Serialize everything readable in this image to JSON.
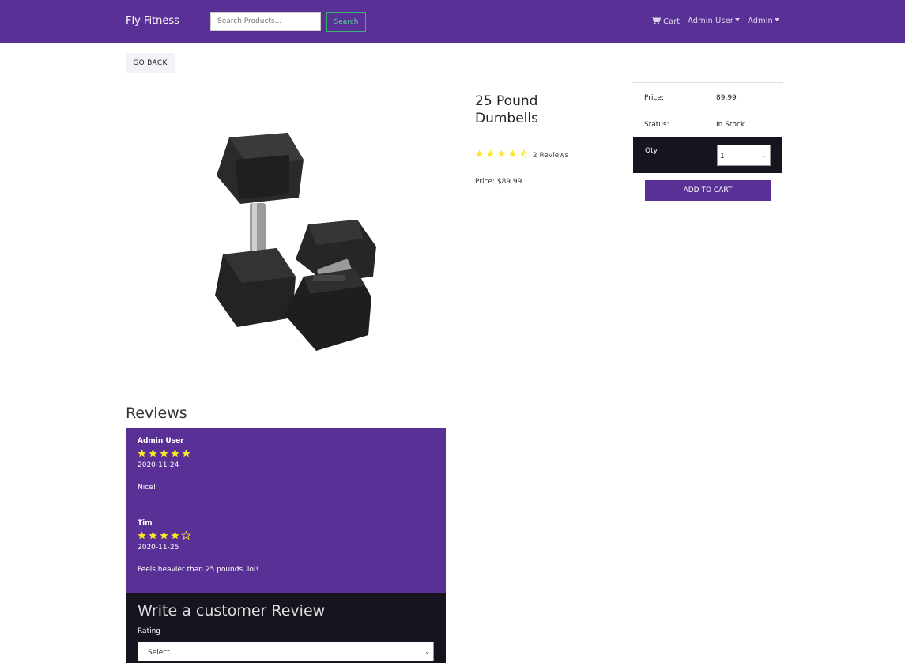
{
  "nav": {
    "brand": "Fly Fitness",
    "search_placeholder": "Search Products...",
    "search_button": "Search",
    "cart": "Cart",
    "user_menu": "Admin User",
    "admin_menu": "Admin"
  },
  "go_back": "GO BACK",
  "product": {
    "name": "25 Pound Dumbells",
    "rating": 4.5,
    "review_count_text": "2 Reviews",
    "price_line": "Price: $89.99"
  },
  "price_card": {
    "price_label": "Price:",
    "price_value": "89.99",
    "status_label": "Status:",
    "status_value": "In Stock",
    "qty_label": "Qty",
    "qty_value": "1",
    "add_to_cart": "ADD TO CART"
  },
  "reviews": {
    "heading": "Reviews",
    "items": [
      {
        "name": "Admin User",
        "rating": 5,
        "date": "2020-11-24",
        "comment": "Nice!"
      },
      {
        "name": "Tim",
        "rating": 4,
        "date": "2020-11-25",
        "comment": "Feels heavier than 25 pounds..lol!"
      }
    ]
  },
  "write_review": {
    "heading": "Write a customer Review",
    "rating_label": "Rating",
    "rating_select": "Select..."
  },
  "colors": {
    "primary": "#593196",
    "dark": "#17141f",
    "star": "#f8e825",
    "success": "#3cb371"
  }
}
